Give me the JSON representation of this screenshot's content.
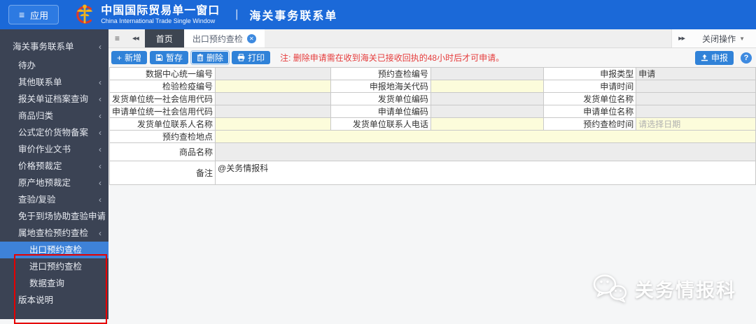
{
  "header": {
    "apps_button": "应用",
    "brand_title": "中国国际贸易单一窗口",
    "brand_subtitle": "China International Trade Single Window",
    "divider": "|",
    "module_title": "海关事务联系单"
  },
  "icons": {
    "menu_glyph": "≡",
    "collapse_glyph": "◀◀",
    "expand_glyph": "▶▶",
    "close_glyph": "✕",
    "caret_glyph": "▼",
    "chevron_glyph": "‹",
    "plus_glyph": "+",
    "help_glyph": "?"
  },
  "sidebar": {
    "items": [
      {
        "label": "海关事务联系单",
        "chevron": true
      },
      {
        "label": "待办",
        "chevron": false
      },
      {
        "label": "其他联系单",
        "chevron": true
      },
      {
        "label": "报关单证档案查询",
        "chevron": true
      },
      {
        "label": "商品归类",
        "chevron": true
      },
      {
        "label": "公式定价货物备案",
        "chevron": true
      },
      {
        "label": "审价作业文书",
        "chevron": true
      },
      {
        "label": "价格预裁定",
        "chevron": true
      },
      {
        "label": "原产地预裁定",
        "chevron": true
      },
      {
        "label": "查验/复验",
        "chevron": true
      },
      {
        "label": "免于到场协助查验申请",
        "chevron": true
      },
      {
        "label": "属地查检预约查检",
        "chevron": true
      },
      {
        "label": "出口预约查检",
        "selected": true
      },
      {
        "label": "进口预约查检"
      },
      {
        "label": "数据查询"
      },
      {
        "label": "版本说明"
      }
    ]
  },
  "tabbar": {
    "home_tab": "首页",
    "current_tab": "出口预约查检",
    "close_menu": "关闭操作"
  },
  "toolbar": {
    "new_label": "新增",
    "save_label": "暂存",
    "delete_label": "删除",
    "print_label": "打印",
    "note": "注: 删除申请需在收到海关已接收回执的48小时后才可申请。",
    "declare_label": "申报"
  },
  "form": {
    "rows": [
      {
        "label1": "数据中心统一编号",
        "value1": "",
        "label2": "预约查检编号",
        "value2": "",
        "label3": "申报类型",
        "value3": "申请"
      },
      {
        "label1": "检验检疫编号",
        "value1": "",
        "label2": "申报地海关代码",
        "value2": "",
        "label3": "申请时间",
        "value3": ""
      },
      {
        "label1": "发货单位统一社会信用代码",
        "value1": "",
        "label2": "发货单位编码",
        "value2": "",
        "label3": "发货单位名称",
        "value3": ""
      },
      {
        "label1": "申请单位统一社会信用代码",
        "value1": "",
        "label2": "申请单位编码",
        "value2": "",
        "label3": "申请单位名称",
        "value3": ""
      },
      {
        "label1": "发货单位联系人名称",
        "value1": "",
        "label2": "发货单位联系人电话",
        "value2": "",
        "label3": "预约查检时间",
        "placeholder3": "请选择日期"
      },
      {
        "label1": "预约查检地点",
        "value1": ""
      },
      {
        "label1": "商品名称",
        "value1": ""
      },
      {
        "label1": "备注",
        "value1": "@关务情报科"
      }
    ]
  },
  "watermark": {
    "text": "关务情报科"
  }
}
